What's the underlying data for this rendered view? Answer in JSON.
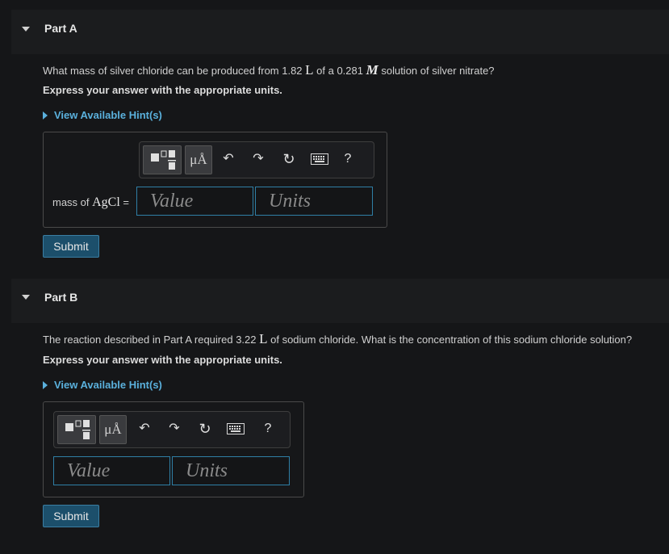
{
  "part_a": {
    "title": "Part A",
    "question_pre": "What mass of silver chloride can be produced from 1.82 ",
    "q_unit1": "L",
    "question_mid": " of a 0.281 ",
    "q_unit2": "M",
    "question_post": " solution of silver nitrate?",
    "instruction": "Express your answer with the appropriate units.",
    "hint": "View Available Hint(s)",
    "answer_label_pre": "mass of ",
    "answer_label_formula": "AgCl",
    "answer_label_post": " =",
    "value_placeholder": "Value",
    "units_placeholder": "Units",
    "submit": "Submit"
  },
  "part_b": {
    "title": "Part B",
    "question_pre": "The reaction described in Part A required 3.22 ",
    "q_unit1": "L",
    "question_post": " of sodium chloride. What is the concentration of this sodium chloride solution?",
    "instruction": "Express your answer with the appropriate units.",
    "hint": "View Available Hint(s)",
    "value_placeholder": "Value",
    "units_placeholder": "Units",
    "submit": "Submit"
  },
  "toolbar": {
    "units_btn": "μÅ",
    "help": "?"
  }
}
